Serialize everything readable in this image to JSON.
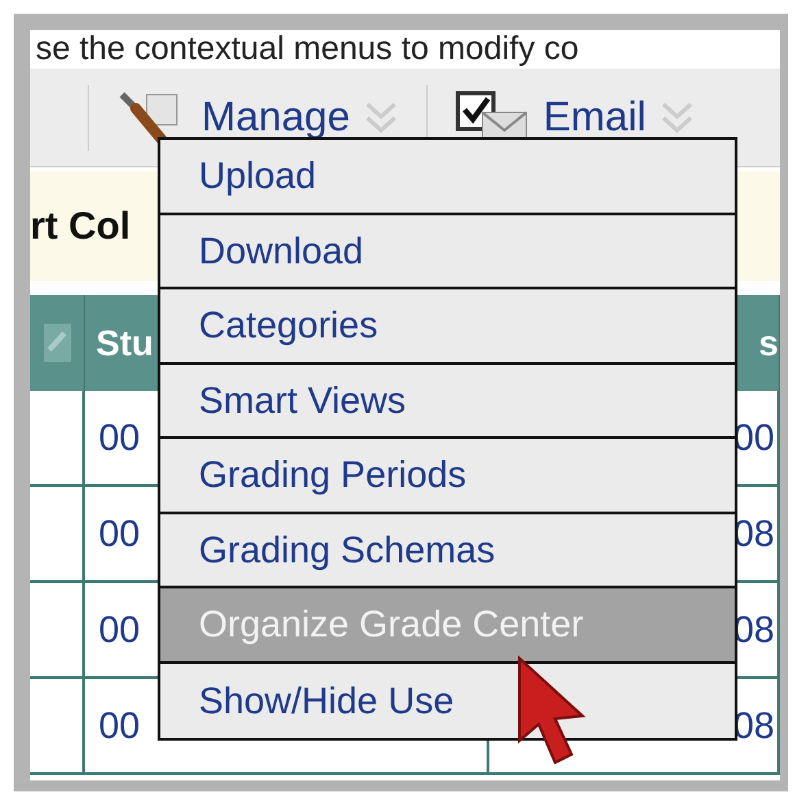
{
  "instruction": "se the contextual menus to modify co",
  "toolbar": [
    {
      "label": "Manage",
      "kind": "manage"
    },
    {
      "label": "Email",
      "kind": "email"
    }
  ],
  "banner": "rt Col",
  "table": {
    "columns": [
      "Stu",
      "s"
    ],
    "rows": [
      [
        "00",
        "00"
      ],
      [
        "00",
        "08"
      ],
      [
        "00",
        "08"
      ],
      [
        "00",
        "08"
      ]
    ]
  },
  "menu": {
    "items": [
      {
        "label": "Upload",
        "selected": false
      },
      {
        "label": "Download",
        "selected": false
      },
      {
        "label": "Categories",
        "selected": false
      },
      {
        "label": "Smart Views",
        "selected": false
      },
      {
        "label": "Grading Periods",
        "selected": false
      },
      {
        "label": "Grading Schemas",
        "selected": false
      },
      {
        "label": "Organize Grade Center",
        "selected": true
      },
      {
        "label": "Show/Hide Use",
        "selected": false
      }
    ]
  }
}
